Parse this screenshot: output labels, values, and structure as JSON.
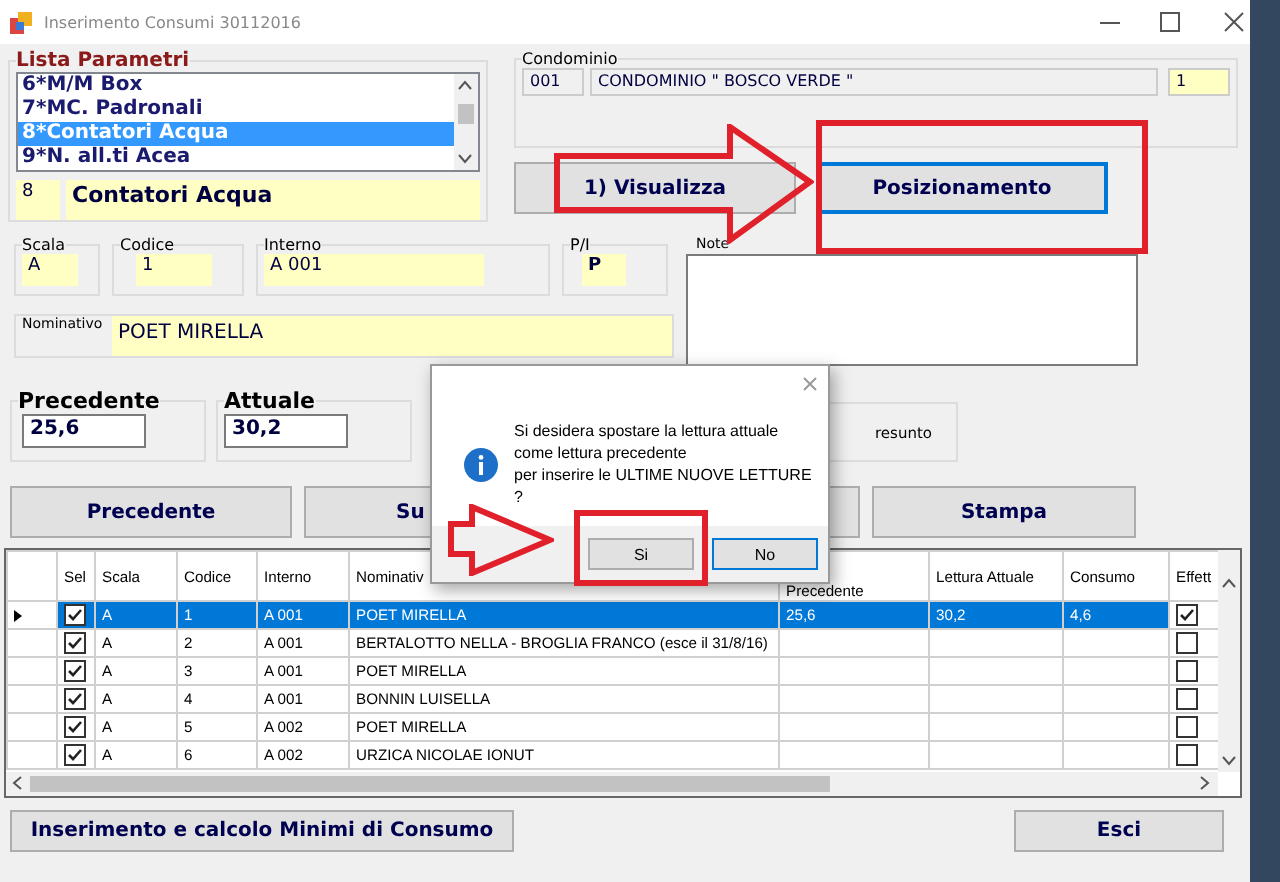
{
  "window": {
    "title": "Inserimento Consumi 30112016"
  },
  "parametri": {
    "title": "Lista Parametri",
    "items": [
      {
        "label": "6*M/M Box",
        "selected": false
      },
      {
        "label": "7*MC. Padronali",
        "selected": false
      },
      {
        "label": "8*Contatori Acqua",
        "selected": true
      },
      {
        "label": "9*N. all.ti Acea",
        "selected": false
      }
    ],
    "code": "8",
    "name": "Contatori Acqua"
  },
  "condominio": {
    "title": "Condominio",
    "code": "001",
    "name": "CONDOMINIO \" BOSCO VERDE \"",
    "number": "1"
  },
  "action_buttons": [
    {
      "label": "1) Visualizza",
      "focused": false
    },
    {
      "label": "Posizionamento",
      "focused": true
    }
  ],
  "fields": [
    {
      "label": "Scala",
      "value": "A"
    },
    {
      "label": "Codice",
      "value": "1"
    },
    {
      "label": "Interno",
      "value": "A 001"
    },
    {
      "label": "P/I",
      "value": "P"
    }
  ],
  "note": {
    "label": "Note"
  },
  "nominativo": {
    "label": "Nominativo",
    "value": "POET MIRELLA"
  },
  "readings": [
    {
      "label": "Precedente",
      "value": "25,6"
    },
    {
      "label": "Attuale",
      "value": "30,2"
    }
  ],
  "presunto": {
    "label": "resunto"
  },
  "nav_buttons": [
    {
      "label": "Precedente"
    },
    {
      "label": "Su"
    },
    {
      "label": "Stampa"
    }
  ],
  "grid": {
    "columns": [
      "Sel",
      "Scala",
      "Codice",
      "Interno",
      "Nominativ",
      "Precedente",
      "Lettura Attuale",
      "Consumo",
      "Effett"
    ],
    "rows": [
      {
        "selected": true,
        "sel": true,
        "scala": "A",
        "codice": "1",
        "interno": "A 001",
        "nominativo": "POET MIRELLA",
        "lettura_precedente": "25,6",
        "lettura_attuale": "30,2",
        "consumo": "4,6",
        "effett": true
      },
      {
        "selected": false,
        "sel": true,
        "scala": "A",
        "codice": "2",
        "interno": "A 001",
        "nominativo": "BERTALOTTO NELLA - BROGLIA FRANCO (esce il 31/8/16)",
        "effett": false
      },
      {
        "selected": false,
        "sel": true,
        "scala": "A",
        "codice": "3",
        "interno": "A 001",
        "nominativo": "POET MIRELLA",
        "effett": false
      },
      {
        "selected": false,
        "sel": true,
        "scala": "A",
        "codice": "4",
        "interno": "A 001",
        "nominativo": "BONNIN LUISELLA",
        "effett": false
      },
      {
        "selected": false,
        "sel": true,
        "scala": "A",
        "codice": "5",
        "interno": "A 002",
        "nominativo": "POET MIRELLA",
        "effett": false
      },
      {
        "selected": false,
        "sel": true,
        "scala": "A",
        "codice": "6",
        "interno": "A 002",
        "nominativo": "URZICA NICOLAE IONUT",
        "effett": false
      }
    ]
  },
  "bottom_buttons": [
    {
      "label": "Inserimento e calcolo Minimi di Consumo"
    },
    {
      "label": "Esci"
    }
  ],
  "dialog": {
    "message": "Si desidera spostare la lettura attuale\ncome lettura precedente\nper inserire le ULTIME NUOVE LETTURE ?",
    "buttons": [
      {
        "label": "Si",
        "default": false
      },
      {
        "label": "No",
        "default": true
      }
    ]
  }
}
